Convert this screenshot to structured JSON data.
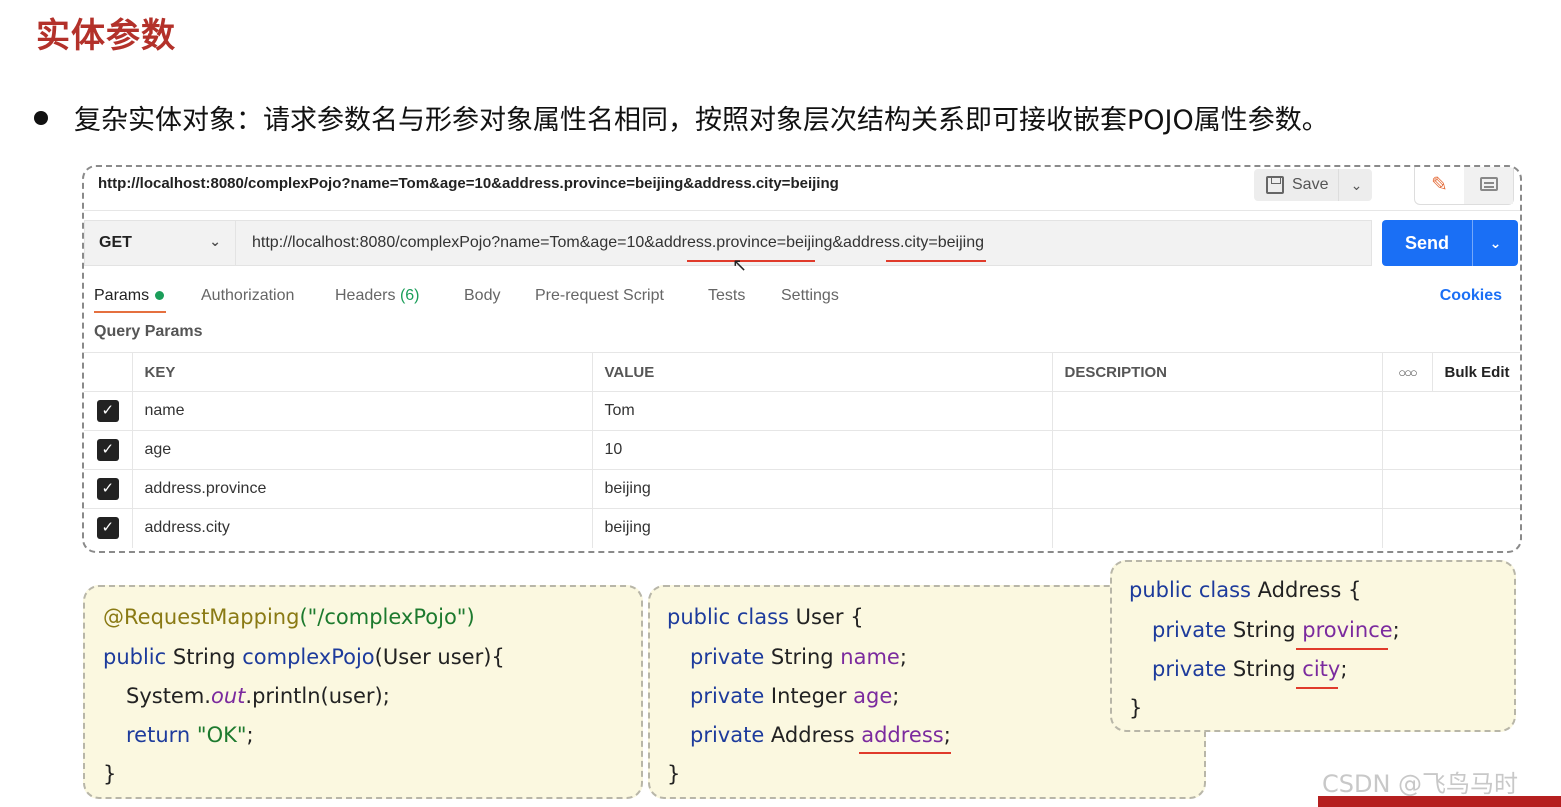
{
  "slide": {
    "title": "实体参数",
    "bullet": "复杂实体对象：请求参数名与形参对象属性名相同，按照对象层次结构关系即可接收嵌套POJO属性参数。"
  },
  "postman": {
    "top_url": "http://localhost:8080/complexPojo?name=Tom&age=10&address.province=beijing&address.city=beijing",
    "save_label": "Save",
    "method": "GET",
    "request_url": "http://localhost:8080/complexPojo?name=Tom&age=10&address.province=beijing&address.city=beijing",
    "send_label": "Send",
    "tabs": {
      "params": "Params",
      "authorization": "Authorization",
      "headers": "Headers",
      "headers_count": "(6)",
      "body": "Body",
      "prerequest": "Pre-request Script",
      "tests": "Tests",
      "settings": "Settings",
      "cookies": "Cookies"
    },
    "query_params_title": "Query Params",
    "table": {
      "headers": {
        "key": "KEY",
        "value": "VALUE",
        "description": "DESCRIPTION",
        "bulk_edit": "Bulk Edit"
      },
      "rows": [
        {
          "key": "name",
          "value": "Tom",
          "checked": true
        },
        {
          "key": "age",
          "value": "10",
          "checked": true
        },
        {
          "key": "address.province",
          "value": "beijing",
          "checked": true
        },
        {
          "key": "address.city",
          "value": "beijing",
          "checked": true
        }
      ]
    }
  },
  "code": {
    "controller": {
      "annotation": "@RequestMapping",
      "annotation_arg": "(\"/complexPojo\")",
      "l2_kw": "public",
      "l2_type": " String ",
      "l2_fn": "complexPojo",
      "l2_rest": "(User user){",
      "l3_a": "System.",
      "l3_b": "out",
      "l3_c": ".println(user);",
      "l4_kw": "return",
      "l4_str": "\"OK\"",
      "l4_end": ";",
      "l5": "}"
    },
    "user": {
      "l1_kw": "public class",
      "l1_rest": " User {",
      "l2_kw": "private",
      "l2_type": " String ",
      "l2_field": "name",
      "l3_kw": "private",
      "l3_type": " Integer ",
      "l3_field": "age",
      "l4_kw": "private",
      "l4_type": " Address ",
      "l4_field": "address",
      "semi": ";",
      "close": "}"
    },
    "address": {
      "l1_kw": "public class",
      "l1_rest": " Address {",
      "l2_kw": "private",
      "l2_type": " String ",
      "l2_field": "province",
      "l3_kw": "private",
      "l3_type": " String ",
      "l3_field": "city",
      "semi": ";",
      "close": "}"
    }
  },
  "watermark": "CSDN @飞鸟马时",
  "colors": {
    "title_red": "#b3312a",
    "send_blue": "#1a6ff5",
    "underline_red": "#e03b2b",
    "code_bg": "#fbf8e0",
    "tab_active_orange": "#e5703f"
  }
}
